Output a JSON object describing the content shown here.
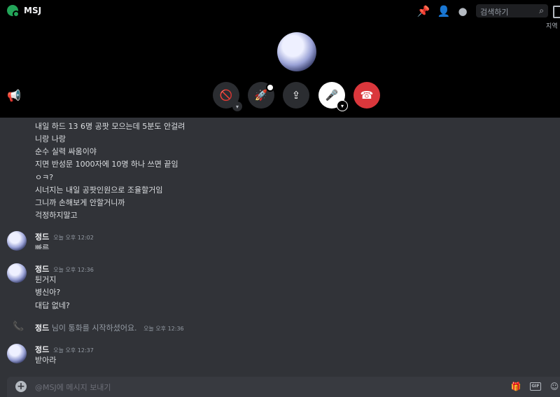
{
  "header": {
    "title": "MSJ",
    "search_placeholder": "검색하기",
    "region_label": "지역",
    "icons": [
      "pin-icon",
      "add-friend-icon",
      "profile-icon",
      "search-icon",
      "inbox-icon"
    ]
  },
  "call": {
    "controls": [
      {
        "name": "camera-toggle",
        "icon": "camera-off-icon"
      },
      {
        "name": "activity",
        "icon": "rocket-icon"
      },
      {
        "name": "screen-share",
        "icon": "screen-share-icon"
      },
      {
        "name": "microphone",
        "icon": "microphone-icon"
      },
      {
        "name": "disconnect",
        "icon": "hangup-icon"
      }
    ]
  },
  "messages": {
    "continuation_lines": [
      "내일 하드 13 6명 공팟 모으는데 5분도 안걸려",
      "니랑 나랑",
      "순수 실력 싸움이야",
      "지면 반성문 1000자에 10명 하나 쓰면 끝임",
      "ㅇㅋ?",
      "시너지는 내일 공팟인원으로 조율할거임",
      "그니까 손해보게 안할거니까",
      "걱정하지말고"
    ],
    "groups": [
      {
        "author": "정드",
        "timestamp": "오늘 오후 12:02",
        "lines": [
          "빠른"
        ]
      },
      {
        "author": "정드",
        "timestamp": "오늘 오후 12:36",
        "lines": [
          "튄거지",
          "병신아?",
          "대답 없네?"
        ]
      },
      {
        "author": "정드",
        "timestamp": "오늘 오후 12:37",
        "lines": [
          "받아라"
        ]
      }
    ],
    "system": {
      "author": "정드",
      "text": "님이 통화를 시작하셨어요.",
      "timestamp": "오늘 오후 12:36"
    }
  },
  "composer": {
    "placeholder": "@MSJ에 메시지 보내기",
    "gif_label": "GIF",
    "icons": [
      "add-icon",
      "gift-icon",
      "gif-icon",
      "sticker-icon"
    ]
  },
  "colors": {
    "background": "#313338",
    "call_background": "#000000",
    "hangup": "#da373c",
    "online": "#23a559"
  }
}
